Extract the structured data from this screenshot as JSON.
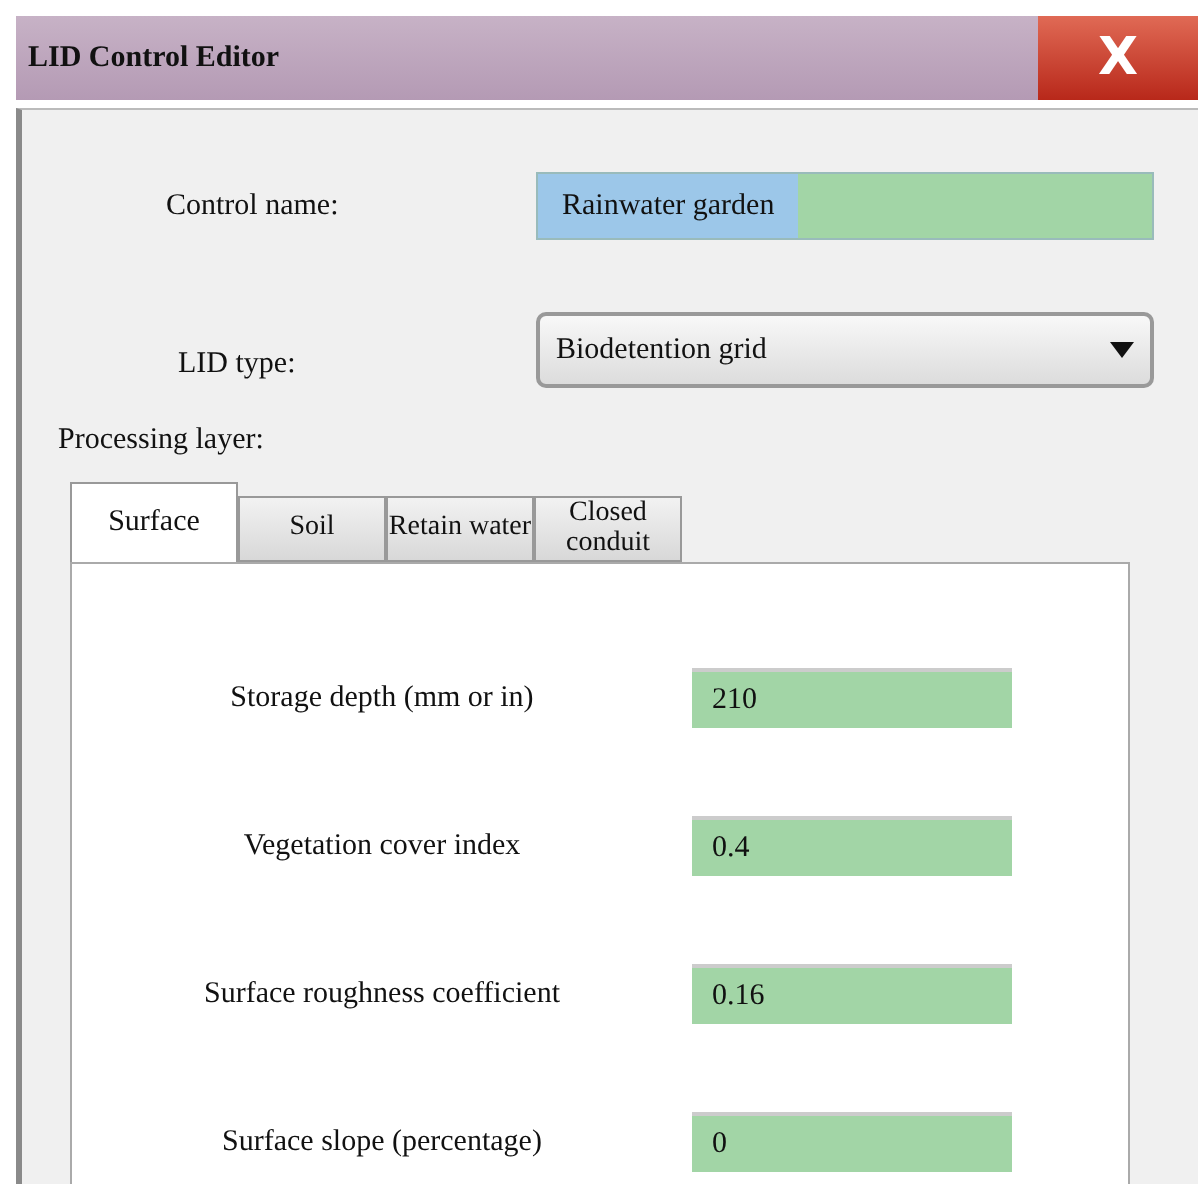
{
  "window": {
    "title": "LID Control Editor",
    "close_label": "X"
  },
  "control_name": {
    "label": "Control name:",
    "value": "Rainwater garden",
    "highlighted": true
  },
  "lid_type": {
    "label": "LID type:",
    "value": "Biodetention grid"
  },
  "layer_label": "Processing layer:",
  "tabs": [
    {
      "label": "Surface",
      "selected": true
    },
    {
      "label": "Soil",
      "selected": false
    },
    {
      "label": "Retain water",
      "selected": false
    },
    {
      "label": "Closed conduit",
      "selected": false
    }
  ],
  "fields": [
    {
      "label": "Storage depth (mm or in)",
      "value": "210"
    },
    {
      "label": "Vegetation cover index",
      "value": "0.4"
    },
    {
      "label": "Surface roughness coefficient",
      "value": "0.16"
    },
    {
      "label": "Surface slope (percentage)",
      "value": "0"
    }
  ]
}
